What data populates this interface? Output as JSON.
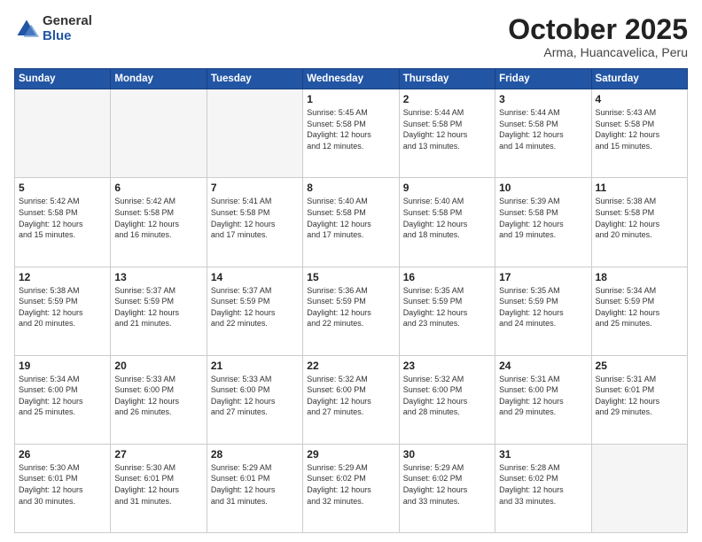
{
  "header": {
    "logo_general": "General",
    "logo_blue": "Blue",
    "month_title": "October 2025",
    "subtitle": "Arma, Huancavelica, Peru"
  },
  "days_of_week": [
    "Sunday",
    "Monday",
    "Tuesday",
    "Wednesday",
    "Thursday",
    "Friday",
    "Saturday"
  ],
  "weeks": [
    [
      {
        "day": "",
        "info": ""
      },
      {
        "day": "",
        "info": ""
      },
      {
        "day": "",
        "info": ""
      },
      {
        "day": "1",
        "info": "Sunrise: 5:45 AM\nSunset: 5:58 PM\nDaylight: 12 hours\nand 12 minutes."
      },
      {
        "day": "2",
        "info": "Sunrise: 5:44 AM\nSunset: 5:58 PM\nDaylight: 12 hours\nand 13 minutes."
      },
      {
        "day": "3",
        "info": "Sunrise: 5:44 AM\nSunset: 5:58 PM\nDaylight: 12 hours\nand 14 minutes."
      },
      {
        "day": "4",
        "info": "Sunrise: 5:43 AM\nSunset: 5:58 PM\nDaylight: 12 hours\nand 15 minutes."
      }
    ],
    [
      {
        "day": "5",
        "info": "Sunrise: 5:42 AM\nSunset: 5:58 PM\nDaylight: 12 hours\nand 15 minutes."
      },
      {
        "day": "6",
        "info": "Sunrise: 5:42 AM\nSunset: 5:58 PM\nDaylight: 12 hours\nand 16 minutes."
      },
      {
        "day": "7",
        "info": "Sunrise: 5:41 AM\nSunset: 5:58 PM\nDaylight: 12 hours\nand 17 minutes."
      },
      {
        "day": "8",
        "info": "Sunrise: 5:40 AM\nSunset: 5:58 PM\nDaylight: 12 hours\nand 17 minutes."
      },
      {
        "day": "9",
        "info": "Sunrise: 5:40 AM\nSunset: 5:58 PM\nDaylight: 12 hours\nand 18 minutes."
      },
      {
        "day": "10",
        "info": "Sunrise: 5:39 AM\nSunset: 5:58 PM\nDaylight: 12 hours\nand 19 minutes."
      },
      {
        "day": "11",
        "info": "Sunrise: 5:38 AM\nSunset: 5:58 PM\nDaylight: 12 hours\nand 20 minutes."
      }
    ],
    [
      {
        "day": "12",
        "info": "Sunrise: 5:38 AM\nSunset: 5:59 PM\nDaylight: 12 hours\nand 20 minutes."
      },
      {
        "day": "13",
        "info": "Sunrise: 5:37 AM\nSunset: 5:59 PM\nDaylight: 12 hours\nand 21 minutes."
      },
      {
        "day": "14",
        "info": "Sunrise: 5:37 AM\nSunset: 5:59 PM\nDaylight: 12 hours\nand 22 minutes."
      },
      {
        "day": "15",
        "info": "Sunrise: 5:36 AM\nSunset: 5:59 PM\nDaylight: 12 hours\nand 22 minutes."
      },
      {
        "day": "16",
        "info": "Sunrise: 5:35 AM\nSunset: 5:59 PM\nDaylight: 12 hours\nand 23 minutes."
      },
      {
        "day": "17",
        "info": "Sunrise: 5:35 AM\nSunset: 5:59 PM\nDaylight: 12 hours\nand 24 minutes."
      },
      {
        "day": "18",
        "info": "Sunrise: 5:34 AM\nSunset: 5:59 PM\nDaylight: 12 hours\nand 25 minutes."
      }
    ],
    [
      {
        "day": "19",
        "info": "Sunrise: 5:34 AM\nSunset: 6:00 PM\nDaylight: 12 hours\nand 25 minutes."
      },
      {
        "day": "20",
        "info": "Sunrise: 5:33 AM\nSunset: 6:00 PM\nDaylight: 12 hours\nand 26 minutes."
      },
      {
        "day": "21",
        "info": "Sunrise: 5:33 AM\nSunset: 6:00 PM\nDaylight: 12 hours\nand 27 minutes."
      },
      {
        "day": "22",
        "info": "Sunrise: 5:32 AM\nSunset: 6:00 PM\nDaylight: 12 hours\nand 27 minutes."
      },
      {
        "day": "23",
        "info": "Sunrise: 5:32 AM\nSunset: 6:00 PM\nDaylight: 12 hours\nand 28 minutes."
      },
      {
        "day": "24",
        "info": "Sunrise: 5:31 AM\nSunset: 6:00 PM\nDaylight: 12 hours\nand 29 minutes."
      },
      {
        "day": "25",
        "info": "Sunrise: 5:31 AM\nSunset: 6:01 PM\nDaylight: 12 hours\nand 29 minutes."
      }
    ],
    [
      {
        "day": "26",
        "info": "Sunrise: 5:30 AM\nSunset: 6:01 PM\nDaylight: 12 hours\nand 30 minutes."
      },
      {
        "day": "27",
        "info": "Sunrise: 5:30 AM\nSunset: 6:01 PM\nDaylight: 12 hours\nand 31 minutes."
      },
      {
        "day": "28",
        "info": "Sunrise: 5:29 AM\nSunset: 6:01 PM\nDaylight: 12 hours\nand 31 minutes."
      },
      {
        "day": "29",
        "info": "Sunrise: 5:29 AM\nSunset: 6:02 PM\nDaylight: 12 hours\nand 32 minutes."
      },
      {
        "day": "30",
        "info": "Sunrise: 5:29 AM\nSunset: 6:02 PM\nDaylight: 12 hours\nand 33 minutes."
      },
      {
        "day": "31",
        "info": "Sunrise: 5:28 AM\nSunset: 6:02 PM\nDaylight: 12 hours\nand 33 minutes."
      },
      {
        "day": "",
        "info": ""
      }
    ]
  ]
}
